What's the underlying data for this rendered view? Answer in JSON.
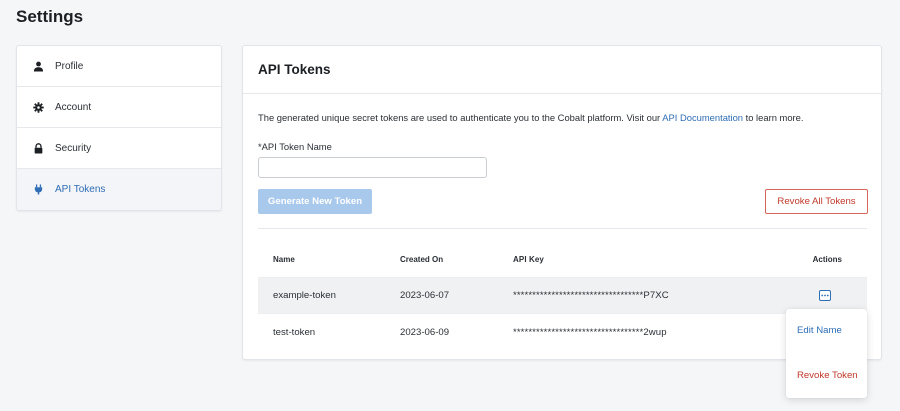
{
  "page": {
    "title": "Settings"
  },
  "sidebar": {
    "items": [
      {
        "label": "Profile",
        "icon": "user-icon",
        "active": false
      },
      {
        "label": "Account",
        "icon": "gear-icon",
        "active": false
      },
      {
        "label": "Security",
        "icon": "lock-icon",
        "active": false
      },
      {
        "label": "API Tokens",
        "icon": "plug-icon",
        "active": true
      }
    ]
  },
  "card": {
    "title": "API Tokens",
    "description_prefix": "The generated unique secret tokens are used to authenticate you to the Cobalt platform. Visit our ",
    "description_link": "API Documentation",
    "description_suffix": " to learn more.",
    "token_name_label": "*API Token Name",
    "token_name_value": "",
    "generate_button": "Generate New Token",
    "revoke_all_button": "Revoke All Tokens"
  },
  "table": {
    "columns": [
      "Name",
      "Created On",
      "API Key",
      "Actions"
    ],
    "rows": [
      {
        "name": "example-token",
        "created": "2023-06-07",
        "key": "**********************************P7XC"
      },
      {
        "name": "test-token",
        "created": "2023-06-09",
        "key": "**********************************2wup"
      }
    ]
  },
  "menu": {
    "edit_label": "Edit Name",
    "revoke_label": "Revoke Token"
  },
  "colors": {
    "accent": "#2f6db5",
    "danger": "#c0392b",
    "button_disabled": "#a8c8ec",
    "background": "#f5f6f8"
  }
}
